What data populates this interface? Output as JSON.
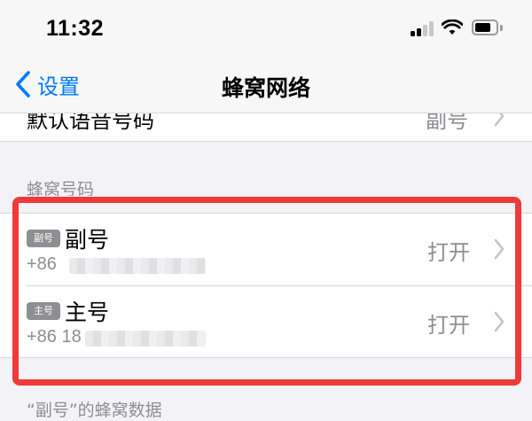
{
  "status_bar": {
    "time": "11:32"
  },
  "nav": {
    "back_label": "设置",
    "title": "蜂窝网络"
  },
  "top_row": {
    "label": "默认语音号码",
    "value": "副号"
  },
  "section": {
    "header": "蜂窝号码"
  },
  "lines": [
    {
      "badge": "副号",
      "name": "副号",
      "number": "+86",
      "status": "打开"
    },
    {
      "badge": "主号",
      "name": "主号",
      "number": "+86 18",
      "status": "打开"
    }
  ],
  "footer": {
    "label": "“副号”的蜂窝数据"
  },
  "colors": {
    "accent": "#007aff",
    "highlight": "#f03a3a",
    "secondary_text": "#8e8e93"
  }
}
